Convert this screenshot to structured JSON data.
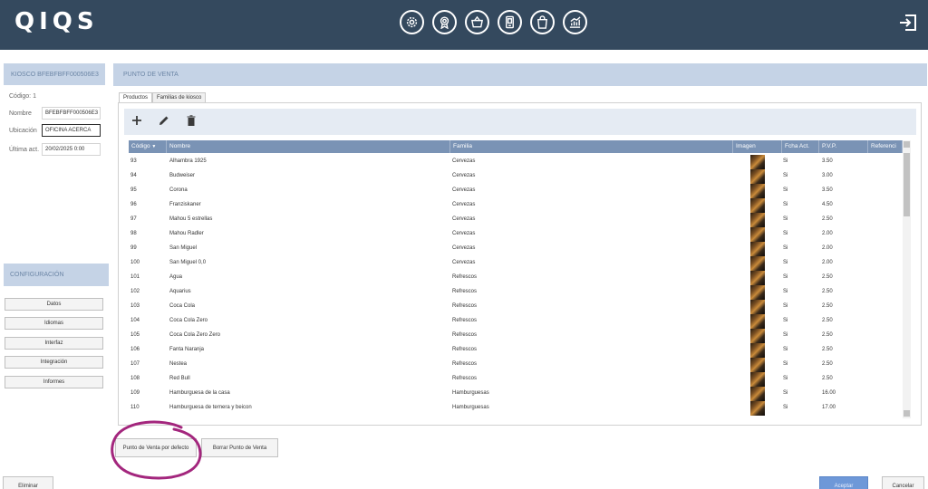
{
  "app": {
    "logo": "QIQS",
    "top_icons": [
      "settings-icon",
      "badge-icon",
      "basket-icon",
      "kiosk-icon",
      "shopping-bag-icon",
      "stats-icon"
    ],
    "logout_icon": "logout-icon"
  },
  "left": {
    "header": "KIOSCO  BFEBFBFF000506E3",
    "codigo": "Código: 1",
    "nombre_label": "Nombre",
    "nombre_value": "BFEBFBFF000506E3",
    "ubicacion_label": "Ubicación",
    "ubicacion_value": "OFICINA ACERCA",
    "ultima_label": "Última act.",
    "ultima_value": "20/02/2025 0:00",
    "config_header": "CONFIGURACIÓN",
    "config_buttons": [
      "Datos",
      "Idiomas",
      "Interfaz",
      "Integración",
      "Informes"
    ]
  },
  "right": {
    "header": "PUNTO DE VENTA",
    "tabs": [
      "Productos",
      "Familias de kiosco"
    ],
    "toolbar_icons": [
      "add-icon",
      "edit-icon",
      "delete-icon"
    ],
    "columns": [
      "Código",
      "Nombre",
      "Familia",
      "Imagen",
      "Fcha Act.",
      "P.V.P.",
      "Referenci"
    ],
    "rows": [
      {
        "codigo": "93",
        "nombre": "Alhambra 1925",
        "familia": "Cervezas",
        "fcha": "Si",
        "pvp": "3.50"
      },
      {
        "codigo": "94",
        "nombre": "Budweiser",
        "familia": "Cervezas",
        "fcha": "Si",
        "pvp": "3.00"
      },
      {
        "codigo": "95",
        "nombre": "Corona",
        "familia": "Cervezas",
        "fcha": "Si",
        "pvp": "3.50"
      },
      {
        "codigo": "96",
        "nombre": "Franziskaner",
        "familia": "Cervezas",
        "fcha": "Si",
        "pvp": "4.50"
      },
      {
        "codigo": "97",
        "nombre": "Mahou 5 estrellas",
        "familia": "Cervezas",
        "fcha": "Si",
        "pvp": "2.50"
      },
      {
        "codigo": "98",
        "nombre": "Mahou Radler",
        "familia": "Cervezas",
        "fcha": "Si",
        "pvp": "2.00"
      },
      {
        "codigo": "99",
        "nombre": "San Miguel",
        "familia": "Cervezas",
        "fcha": "Si",
        "pvp": "2.00"
      },
      {
        "codigo": "100",
        "nombre": "San Miguel 0,0",
        "familia": "Cervezas",
        "fcha": "Si",
        "pvp": "2.00"
      },
      {
        "codigo": "101",
        "nombre": "Agua",
        "familia": "Refrescos",
        "fcha": "Si",
        "pvp": "2.50"
      },
      {
        "codigo": "102",
        "nombre": "Aquarius",
        "familia": "Refrescos",
        "fcha": "Si",
        "pvp": "2.50"
      },
      {
        "codigo": "103",
        "nombre": "Coca Cola",
        "familia": "Refrescos",
        "fcha": "Si",
        "pvp": "2.50"
      },
      {
        "codigo": "104",
        "nombre": "Coca Cola Zero",
        "familia": "Refrescos",
        "fcha": "Si",
        "pvp": "2.50"
      },
      {
        "codigo": "105",
        "nombre": "Coca Cola Zero Zero",
        "familia": "Refrescos",
        "fcha": "Si",
        "pvp": "2.50"
      },
      {
        "codigo": "106",
        "nombre": "Fanta Naranja",
        "familia": "Refrescos",
        "fcha": "Si",
        "pvp": "2.50"
      },
      {
        "codigo": "107",
        "nombre": "Nestea",
        "familia": "Refrescos",
        "fcha": "Si",
        "pvp": "2.50"
      },
      {
        "codigo": "108",
        "nombre": "Red Bull",
        "familia": "Refrescos",
        "fcha": "Si",
        "pvp": "2.50"
      },
      {
        "codigo": "109",
        "nombre": "Hamburguesa de la casa",
        "familia": "Hamburguesas",
        "fcha": "Si",
        "pvp": "16.00"
      },
      {
        "codigo": "110",
        "nombre": "Hamburguesa de ternera y beicon",
        "familia": "Hamburguesas",
        "fcha": "Si",
        "pvp": "17.00"
      }
    ],
    "btn_default": "Punto de Venta por defecto",
    "btn_delete": "Borrar Punto de Venta"
  },
  "footer": {
    "eliminar": "Eliminar",
    "aceptar": "Aceptar",
    "cancelar": "Cancelar"
  },
  "colors": {
    "topbar": "#34495e",
    "panel_header": "#c5d3e6",
    "table_header": "#7a93b5",
    "annotation": "#a3267d"
  }
}
